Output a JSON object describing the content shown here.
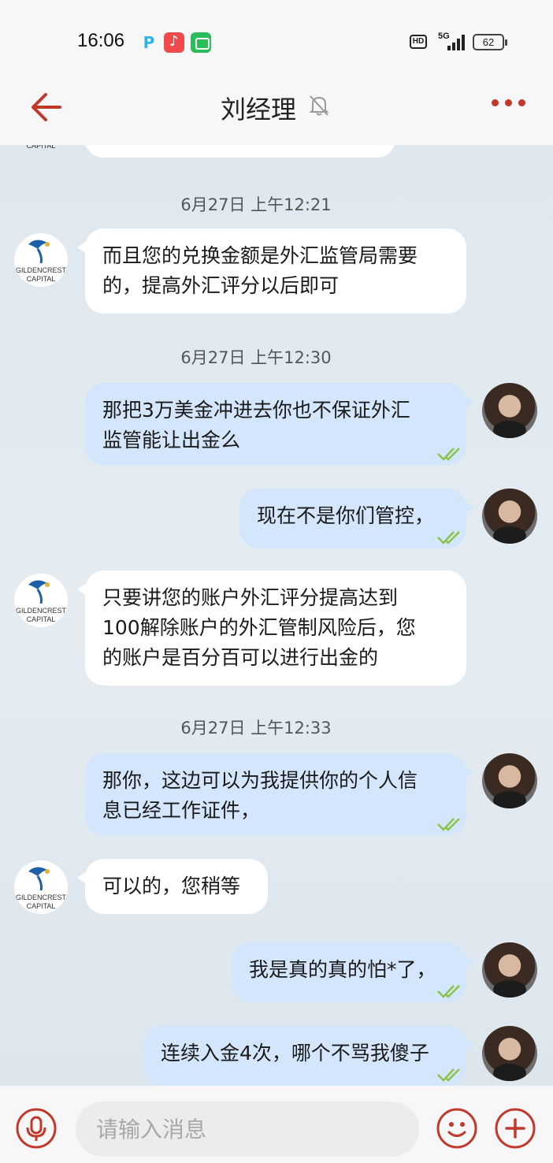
{
  "status_bar": {
    "time": "16:06",
    "p_app_glyph": "P",
    "hd_label": "HD",
    "network": "5G",
    "battery": "62",
    "icons": [
      "p-app-icon",
      "music-app-icon",
      "messages-app-icon",
      "hd-icon",
      "signal-icon",
      "battery-icon"
    ]
  },
  "nav": {
    "title": "刘经理",
    "icons": [
      "back-arrow-icon",
      "mute-bell-icon",
      "more-dots-icon"
    ]
  },
  "company_avatar": {
    "line1": "GILDENCREST",
    "line2": "CAPITAL"
  },
  "timestamps": [
    "6月27日 上午12:21",
    "6月27日 上午12:30",
    "6月27日 上午12:33"
  ],
  "messages": [
    {
      "side": "in",
      "text_lines": [
        "而且您的兑换金额是外汇监管局需要",
        "的，提高外汇评分以后即可"
      ]
    },
    {
      "side": "out",
      "text_lines": [
        "那把3万美金冲进去你也不保证外汇",
        "监管能让出金么"
      ]
    },
    {
      "side": "out",
      "text_lines": [
        "现在不是你们管控，"
      ]
    },
    {
      "side": "in",
      "text_lines": [
        "只要讲您的账户外汇评分提高达到",
        "100解除账户的外汇管制风险后，您",
        "的账户是百分百可以进行出金的"
      ]
    },
    {
      "side": "out",
      "text_lines": [
        "那你，这边可以为我提供你的个人信",
        "息已经工作证件，"
      ]
    },
    {
      "side": "in",
      "text_lines": [
        "可以的，您稍等"
      ]
    },
    {
      "side": "out",
      "text_lines": [
        "我是真的真的怕*了，"
      ]
    },
    {
      "side": "out",
      "text_lines": [
        "连续入金4次，哪个不骂我傻子"
      ]
    }
  ],
  "input": {
    "placeholder": "请输入消息"
  },
  "colors": {
    "accent_red": "#c0392b",
    "out_bubble": "#d3e6fb",
    "in_bubble": "#ffffff",
    "tick_green": "#8bc34a"
  }
}
